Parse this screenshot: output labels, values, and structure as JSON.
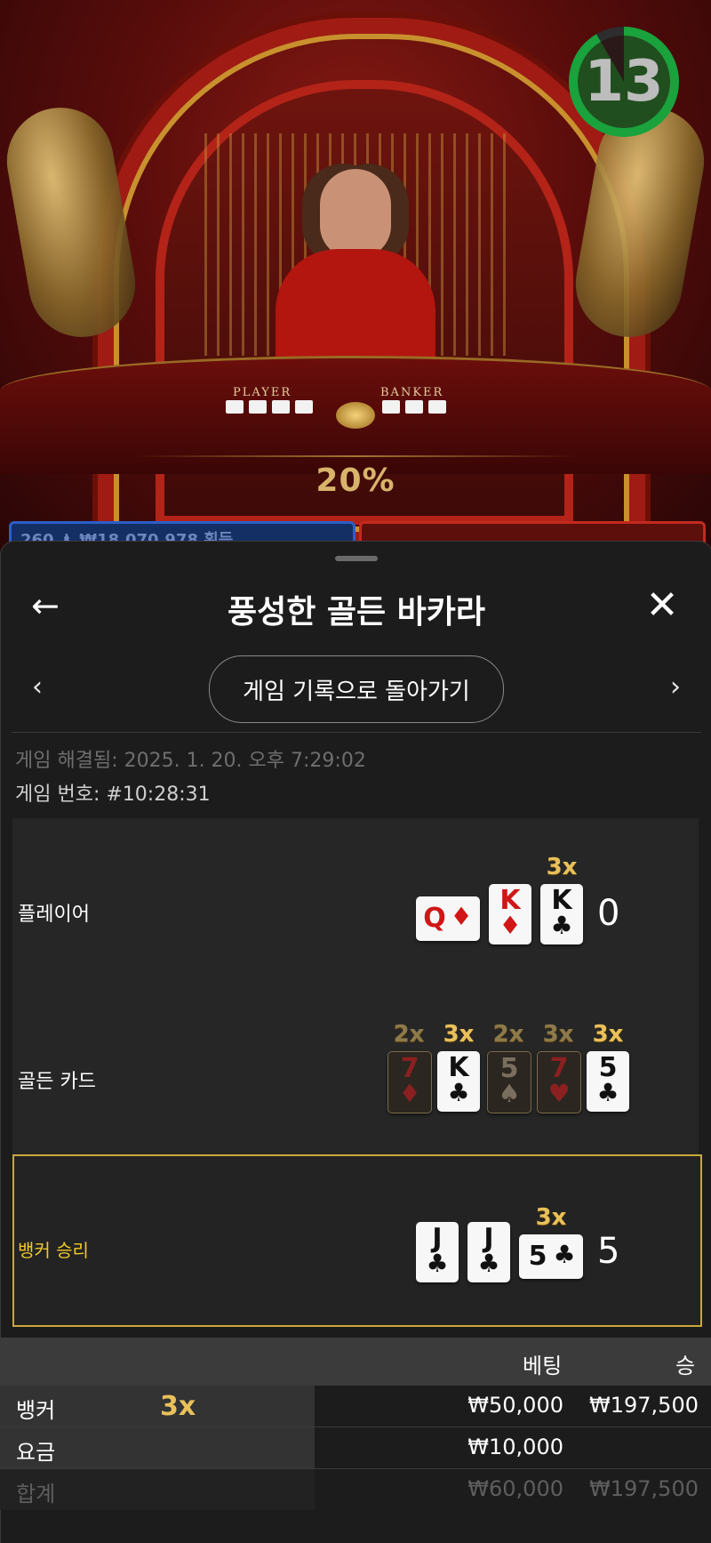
{
  "video": {
    "timer": "13",
    "percent": "20%",
    "player_label": "PLAYER",
    "banker_label": "BANKER",
    "bet_strip_text": "260 ♟ ₩18,070,978 획득"
  },
  "header": {
    "title": "풍성한 골든 바카라",
    "back_icon": "arrow-left-icon",
    "close_icon": "close-icon"
  },
  "nav": {
    "prev_icon": "chevron-left-icon",
    "next_icon": "chevron-right-icon",
    "history_button": "게임 기록으로 돌아가기"
  },
  "game_info": {
    "resolved": "게임 해결됨: 2025. 1. 20. 오후 7:29:02",
    "number": "게임 번호: #10:28:31"
  },
  "player": {
    "label": "플레이어",
    "score": "0",
    "cards": [
      {
        "rank": "Q",
        "suit": "♦",
        "color": "red",
        "side": true
      },
      {
        "rank": "K",
        "suit": "♦",
        "color": "red"
      },
      {
        "rank": "K",
        "suit": "♣",
        "color": "black",
        "multiplier": "3x"
      }
    ]
  },
  "golden": {
    "label": "골든 카드",
    "cards": [
      {
        "rank": "7",
        "suit": "♦",
        "color": "red",
        "dim": true,
        "multiplier": "2x"
      },
      {
        "rank": "K",
        "suit": "♣",
        "color": "black",
        "multiplier": "3x"
      },
      {
        "rank": "5",
        "suit": "♠",
        "color": "black",
        "dim": true,
        "multiplier": "2x"
      },
      {
        "rank": "7",
        "suit": "♥",
        "color": "red",
        "dim": true,
        "multiplier": "3x"
      },
      {
        "rank": "5",
        "suit": "♣",
        "color": "black",
        "multiplier": "3x"
      }
    ]
  },
  "banker": {
    "label": "뱅커 승리",
    "score": "5",
    "cards": [
      {
        "rank": "J",
        "suit": "♣",
        "color": "black"
      },
      {
        "rank": "J",
        "suit": "♣",
        "color": "black"
      },
      {
        "rank": "5",
        "suit": "♣",
        "color": "black",
        "side": true,
        "multiplier": "3x"
      }
    ]
  },
  "bets": {
    "col_bet": "베팅",
    "col_win": "승",
    "rows": [
      {
        "label": "뱅커",
        "multiplier": "3x",
        "bet": "₩50,000",
        "win": "₩197,500"
      },
      {
        "label": "요금",
        "bet": "₩10,000",
        "win": ""
      },
      {
        "label": "합계",
        "bet": "₩60,000",
        "win": "₩197,500"
      }
    ]
  },
  "colors": {
    "gold": "#e9c05a",
    "winner_border": "#c9a93a",
    "winner_text": "#f0c929",
    "timer_green": "#1aa23c"
  }
}
